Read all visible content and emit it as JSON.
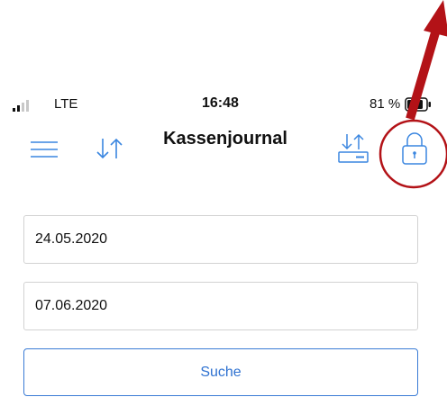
{
  "status_bar": {
    "network": "LTE",
    "time": "16:48",
    "battery": "81 %"
  },
  "nav": {
    "title": "Kassenjournal",
    "icons": [
      "menu-icon",
      "sort-icon",
      "export-icon",
      "lock-icon"
    ]
  },
  "form": {
    "date_from": "24.05.2020",
    "date_to": "07.06.2020",
    "search_label": "Suche"
  },
  "colors": {
    "accent": "#2f72d1",
    "icon_blue": "#3a86e0",
    "annotation_red": "#b31217",
    "field_border": "#d2d2d2"
  }
}
